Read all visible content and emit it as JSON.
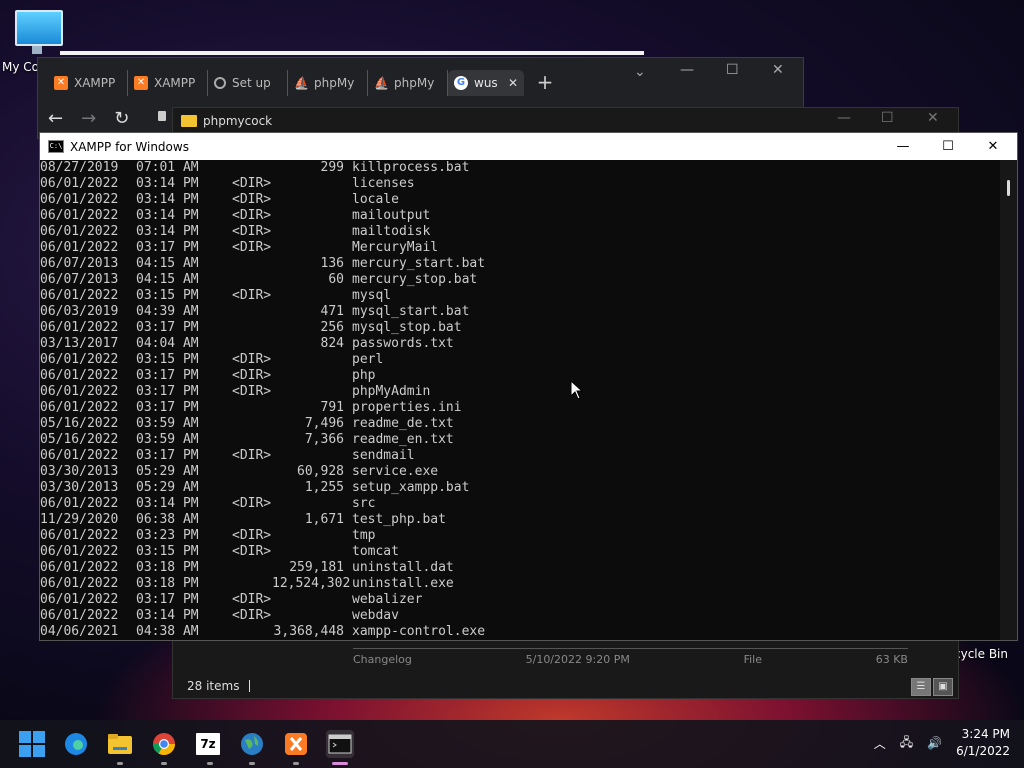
{
  "desktop": {
    "icons": [
      {
        "label": "My Co",
        "icon": "computer-icon"
      },
      {
        "label": "cycle Bin",
        "icon": "recycle-bin-icon"
      }
    ]
  },
  "browser": {
    "tabs": [
      {
        "label": "XAMPP",
        "icon": "xampp-icon"
      },
      {
        "label": "XAMPP",
        "icon": "xampp-icon"
      },
      {
        "label": "Set up",
        "icon": "globe-icon"
      },
      {
        "label": "phpMy",
        "icon": "phpmyadmin-icon"
      },
      {
        "label": "phpMy",
        "icon": "phpmyadmin-icon"
      },
      {
        "label": "wus",
        "icon": "google-icon",
        "active": true
      }
    ],
    "new_tab": "+"
  },
  "explorer": {
    "title": "phpmycock",
    "file_row": {
      "name": "Changelog",
      "date": "5/10/2022 9:20 PM",
      "type": "File",
      "size": "63 KB"
    },
    "status": "28 items"
  },
  "console": {
    "title": "XAMPP for Windows",
    "lines": [
      {
        "date": "08/27/2019",
        "time": "07:01 AM",
        "dir": "",
        "size": "299",
        "name": "killprocess.bat"
      },
      {
        "date": "06/01/2022",
        "time": "03:14 PM",
        "dir": "<DIR>",
        "size": "",
        "name": "licenses"
      },
      {
        "date": "06/01/2022",
        "time": "03:14 PM",
        "dir": "<DIR>",
        "size": "",
        "name": "locale"
      },
      {
        "date": "06/01/2022",
        "time": "03:14 PM",
        "dir": "<DIR>",
        "size": "",
        "name": "mailoutput"
      },
      {
        "date": "06/01/2022",
        "time": "03:14 PM",
        "dir": "<DIR>",
        "size": "",
        "name": "mailtodisk"
      },
      {
        "date": "06/01/2022",
        "time": "03:17 PM",
        "dir": "<DIR>",
        "size": "",
        "name": "MercuryMail"
      },
      {
        "date": "06/07/2013",
        "time": "04:15 AM",
        "dir": "",
        "size": "136",
        "name": "mercury_start.bat"
      },
      {
        "date": "06/07/2013",
        "time": "04:15 AM",
        "dir": "",
        "size": "60",
        "name": "mercury_stop.bat"
      },
      {
        "date": "06/01/2022",
        "time": "03:15 PM",
        "dir": "<DIR>",
        "size": "",
        "name": "mysql"
      },
      {
        "date": "06/03/2019",
        "time": "04:39 AM",
        "dir": "",
        "size": "471",
        "name": "mysql_start.bat"
      },
      {
        "date": "06/01/2022",
        "time": "03:17 PM",
        "dir": "",
        "size": "256",
        "name": "mysql_stop.bat"
      },
      {
        "date": "03/13/2017",
        "time": "04:04 AM",
        "dir": "",
        "size": "824",
        "name": "passwords.txt"
      },
      {
        "date": "06/01/2022",
        "time": "03:15 PM",
        "dir": "<DIR>",
        "size": "",
        "name": "perl"
      },
      {
        "date": "06/01/2022",
        "time": "03:17 PM",
        "dir": "<DIR>",
        "size": "",
        "name": "php"
      },
      {
        "date": "06/01/2022",
        "time": "03:17 PM",
        "dir": "<DIR>",
        "size": "",
        "name": "phpMyAdmin"
      },
      {
        "date": "06/01/2022",
        "time": "03:17 PM",
        "dir": "",
        "size": "791",
        "name": "properties.ini"
      },
      {
        "date": "05/16/2022",
        "time": "03:59 AM",
        "dir": "",
        "size": "7,496",
        "name": "readme_de.txt"
      },
      {
        "date": "05/16/2022",
        "time": "03:59 AM",
        "dir": "",
        "size": "7,366",
        "name": "readme_en.txt"
      },
      {
        "date": "06/01/2022",
        "time": "03:17 PM",
        "dir": "<DIR>",
        "size": "",
        "name": "sendmail"
      },
      {
        "date": "03/30/2013",
        "time": "05:29 AM",
        "dir": "",
        "size": "60,928",
        "name": "service.exe"
      },
      {
        "date": "03/30/2013",
        "time": "05:29 AM",
        "dir": "",
        "size": "1,255",
        "name": "setup_xampp.bat"
      },
      {
        "date": "06/01/2022",
        "time": "03:14 PM",
        "dir": "<DIR>",
        "size": "",
        "name": "src"
      },
      {
        "date": "11/29/2020",
        "time": "06:38 AM",
        "dir": "",
        "size": "1,671",
        "name": "test_php.bat"
      },
      {
        "date": "06/01/2022",
        "time": "03:23 PM",
        "dir": "<DIR>",
        "size": "",
        "name": "tmp"
      },
      {
        "date": "06/01/2022",
        "time": "03:15 PM",
        "dir": "<DIR>",
        "size": "",
        "name": "tomcat"
      },
      {
        "date": "06/01/2022",
        "time": "03:18 PM",
        "dir": "",
        "size": "259,181",
        "name": "uninstall.dat"
      },
      {
        "date": "06/01/2022",
        "time": "03:18 PM",
        "dir": "",
        "size": "12,524,302",
        "name": "uninstall.exe"
      },
      {
        "date": "06/01/2022",
        "time": "03:17 PM",
        "dir": "<DIR>",
        "size": "",
        "name": "webalizer"
      },
      {
        "date": "06/01/2022",
        "time": "03:14 PM",
        "dir": "<DIR>",
        "size": "",
        "name": "webdav"
      },
      {
        "date": "04/06/2021",
        "time": "04:38 AM",
        "dir": "",
        "size": "3,368,448",
        "name": "xampp-control.exe"
      }
    ]
  },
  "taskbar": {
    "apps": [
      {
        "name": "start",
        "icon": "windows-start-icon"
      },
      {
        "name": "edge",
        "icon": "edge-icon"
      },
      {
        "name": "explorer",
        "icon": "folder-icon"
      },
      {
        "name": "chrome",
        "icon": "chrome-icon"
      },
      {
        "name": "7zip",
        "icon": "7zip-icon",
        "label": "7z"
      },
      {
        "name": "globe",
        "icon": "globe-icon"
      },
      {
        "name": "xampp",
        "icon": "xampp-icon"
      },
      {
        "name": "terminal",
        "icon": "terminal-icon",
        "active": true
      }
    ],
    "time": "3:24 PM",
    "date": "6/1/2022"
  }
}
